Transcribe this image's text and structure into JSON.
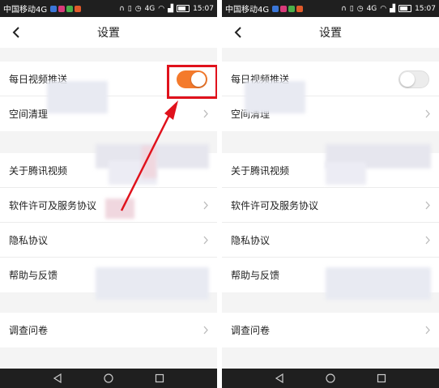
{
  "screens": [
    {
      "statusbar": {
        "carrier": "中国移动4G",
        "network": "4G",
        "time": "15:07"
      },
      "header": {
        "title": "设置"
      },
      "rows": {
        "daily_push": "每日视频推送",
        "clear_space": "空间清理",
        "about": "关于腾讯视频",
        "license": "软件许可及服务协议",
        "privacy": "隐私协议",
        "help": "帮助与反馈",
        "survey": "调查问卷"
      },
      "daily_push_enabled": true
    },
    {
      "statusbar": {
        "carrier": "中国移动4G",
        "network": "4G",
        "time": "15:07"
      },
      "header": {
        "title": "设置"
      },
      "rows": {
        "daily_push": "每日视频推送",
        "clear_space": "空间清理",
        "about": "关于腾讯视频",
        "license": "软件许可及服务协议",
        "privacy": "隐私协议",
        "help": "帮助与反馈",
        "survey": "调查问卷"
      },
      "daily_push_enabled": false
    }
  ],
  "icons": [
    "back-arrow-icon",
    "chevron-right-icon",
    "nav-back-icon",
    "nav-home-icon",
    "nav-recents-icon"
  ],
  "colors": {
    "toggle_on": "#f47a2c",
    "highlight": "#e0121c"
  }
}
